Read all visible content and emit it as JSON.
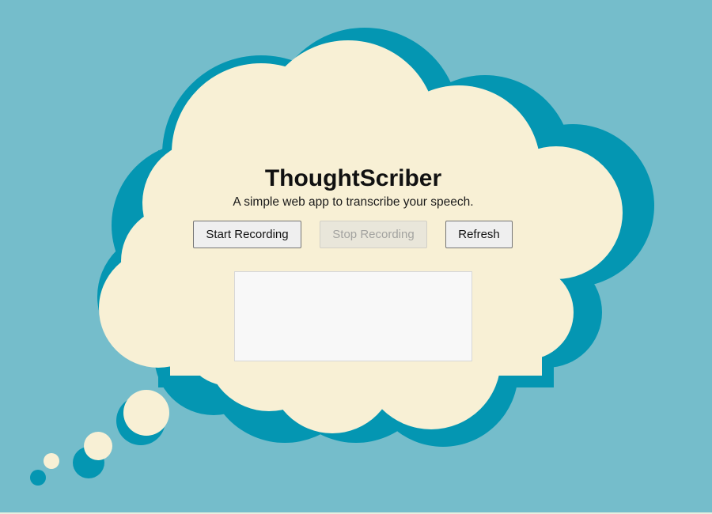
{
  "app": {
    "title": "ThoughtScriber",
    "subtitle": "A simple web app to transcribe your speech."
  },
  "controls": {
    "start_label": "Start Recording",
    "stop_label": "Stop Recording",
    "stop_disabled": true,
    "refresh_label": "Refresh"
  },
  "transcript": {
    "text": ""
  },
  "colors": {
    "background": "#75bdcb",
    "cloud_fill": "#f8f0d5",
    "cloud_shadow": "#0496b2",
    "button_bg": "#efefef",
    "button_disabled_bg": "#e9e6da",
    "transcript_bg": "#f8f8f8"
  }
}
